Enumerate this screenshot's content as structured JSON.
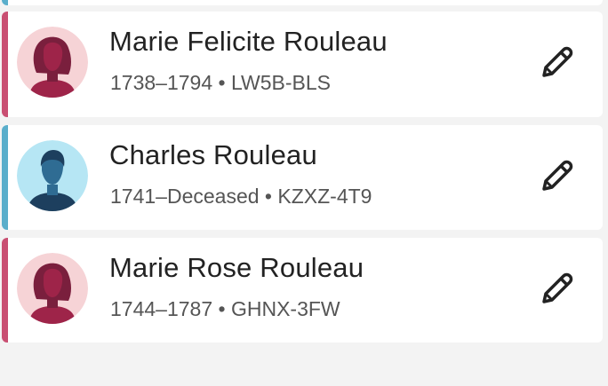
{
  "colors": {
    "female_accent": "#c94f72",
    "male_accent": "#5aaecb",
    "female_avatar_bg": "#f6d3d6",
    "male_avatar_bg": "#b6e6f4"
  },
  "persons": [
    {
      "name": "Marie Felicite Rouleau",
      "dates": "1738–1794",
      "separator": "•",
      "id": "LW5B-BLS",
      "gender": "female",
      "avatar_icon": "female-silhouette-icon",
      "edit_icon": "pencil-icon"
    },
    {
      "name": "Charles Rouleau",
      "dates": "1741–Deceased",
      "separator": "•",
      "id": "KZXZ-4T9",
      "gender": "male",
      "avatar_icon": "male-silhouette-icon",
      "edit_icon": "pencil-icon"
    },
    {
      "name": "Marie Rose Rouleau",
      "dates": "1744–1787",
      "separator": "•",
      "id": "GHNX-3FW",
      "gender": "female",
      "avatar_icon": "female-silhouette-icon",
      "edit_icon": "pencil-icon"
    }
  ]
}
